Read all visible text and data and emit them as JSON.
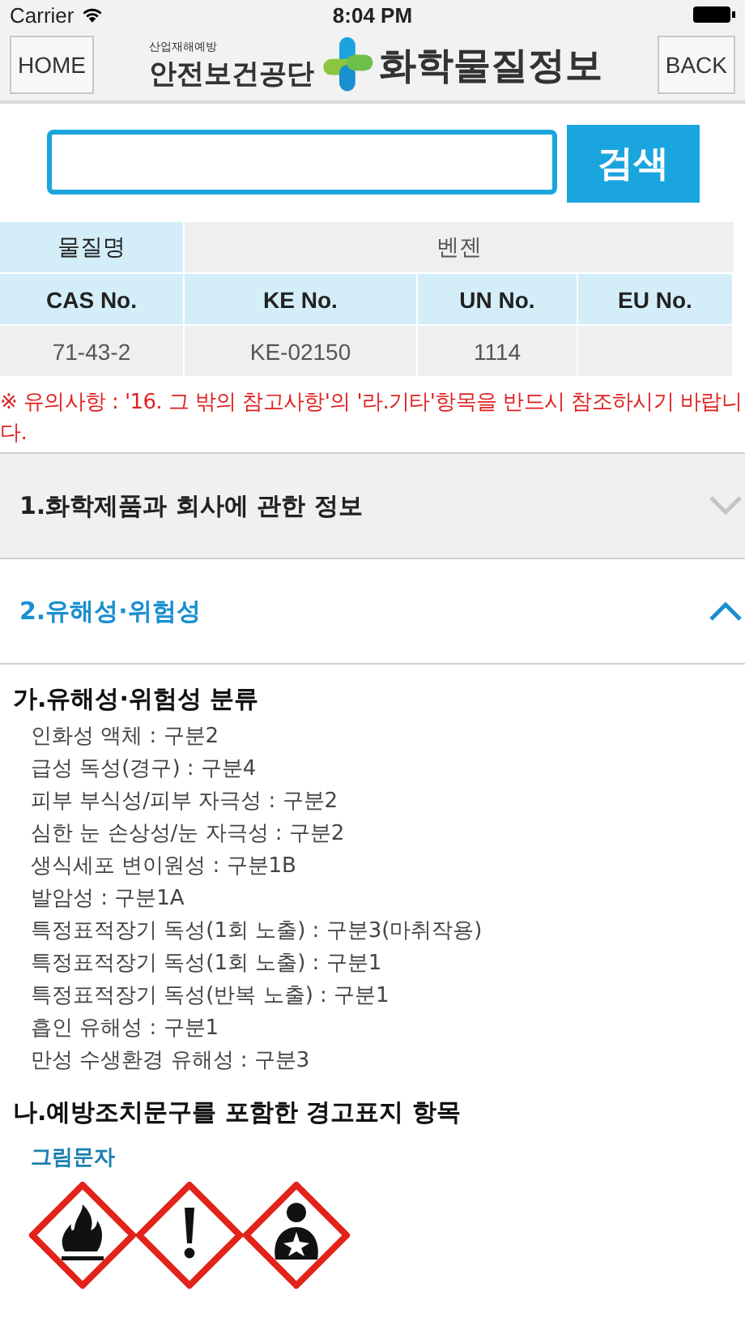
{
  "status_bar": {
    "carrier": "Carrier",
    "time": "8:04 PM"
  },
  "nav": {
    "home": "HOME",
    "back": "BACK",
    "logo_small": "산업재해예방",
    "logo_org": "안전보건공단",
    "logo_title": "화학물질정보"
  },
  "search": {
    "button": "검색"
  },
  "table": {
    "name_label": "물질명",
    "name_value": "벤젠",
    "columns": [
      "CAS No.",
      "KE No.",
      "UN No.",
      "EU No."
    ],
    "row": [
      "71-43-2",
      "KE-02150",
      "1114"
    ]
  },
  "notice": "※ 유의사항 : '16. 그 밖의 참고사항'의 '라.기타'항목을 반드시 참조하시기 바랍니다.",
  "sections": [
    {
      "title": "1.화학제품과 회사에 관한 정보",
      "expanded": false
    },
    {
      "title": "2.유해성·위험성",
      "expanded": true
    }
  ],
  "classification": {
    "title": "가.유해성·위험성 분류",
    "items": [
      "인화성 액체 : 구분2",
      "급성 독성(경구) : 구분4",
      "피부 부식성/피부 자극성 : 구분2",
      "심한 눈 손상성/눈 자극성 : 구분2",
      "생식세포 변이원성 : 구분1B",
      "발암성 : 구분1A",
      "특정표적장기 독성(1회 노출) : 구분3(마취작용)",
      "특정표적장기 독성(1회 노출) : 구분1",
      "특정표적장기 독성(반복 노출) : 구분1",
      "흡인 유해성 : 구분1",
      "만성 수생환경 유해성 : 구분3"
    ]
  },
  "labeling": {
    "title": "나.예방조치문구를 포함한 경고표지 항목",
    "pictogram_label": "그림문자",
    "pictograms": [
      {
        "kind": "flame"
      },
      {
        "kind": "exclamation"
      },
      {
        "kind": "health"
      }
    ]
  }
}
